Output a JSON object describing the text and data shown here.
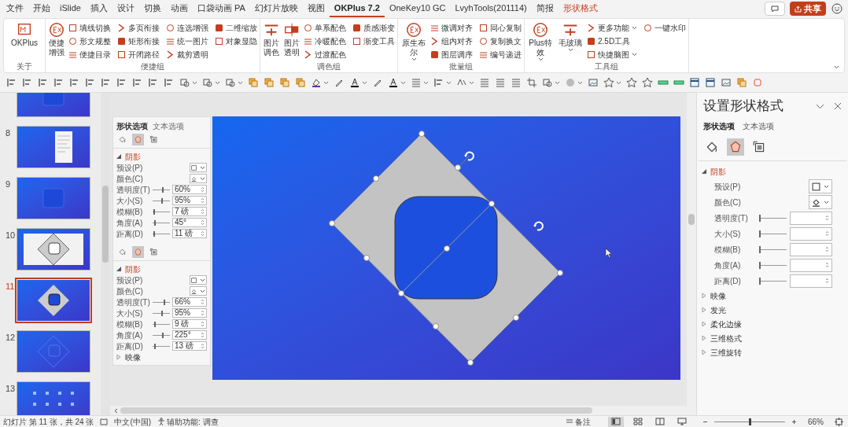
{
  "menu_tabs": [
    {
      "label": "文件",
      "selected": false,
      "kind": "tab"
    },
    {
      "label": "开始",
      "selected": false,
      "kind": "tab"
    },
    {
      "label": "iSlide",
      "selected": false,
      "kind": "tab"
    },
    {
      "label": "插入",
      "selected": false,
      "kind": "tab"
    },
    {
      "label": "设计",
      "selected": false,
      "kind": "tab"
    },
    {
      "label": "切换",
      "selected": false,
      "kind": "tab"
    },
    {
      "label": "动画",
      "selected": false,
      "kind": "tab"
    },
    {
      "label": "口袋动画 PA",
      "selected": false,
      "kind": "tab"
    },
    {
      "label": "幻灯片放映",
      "selected": false,
      "kind": "tab"
    },
    {
      "label": "视图",
      "selected": false,
      "kind": "tab"
    },
    {
      "label": "OKPlus 7.2",
      "selected": true,
      "kind": "tab"
    },
    {
      "label": "OneKey10 GC",
      "selected": false,
      "kind": "tab"
    },
    {
      "label": "LvyhTools(201114)",
      "selected": false,
      "kind": "tab"
    },
    {
      "label": "简报",
      "selected": false,
      "kind": "tab"
    },
    {
      "label": "形状格式",
      "selected": false,
      "kind": "contextual"
    }
  ],
  "share_button": {
    "label": "共享"
  },
  "ribbon": {
    "groups": [
      {
        "label": "关于",
        "large": [
          {
            "label": "OKPlus"
          }
        ]
      },
      {
        "label": "便捷组",
        "large": [
          {
            "label": "便捷增强"
          }
        ],
        "small": [
          {
            "label": "填线切换"
          },
          {
            "label": "形文规整"
          },
          {
            "label": "便捷目录"
          },
          {
            "label": "多页衔接"
          },
          {
            "label": "矩形衔接"
          },
          {
            "label": "开闭路径"
          },
          {
            "label": "连选增强"
          },
          {
            "label": "统一图片"
          },
          {
            "label": "裁剪透明"
          },
          {
            "label": "二维缩放"
          },
          {
            "label": "对象显隐"
          }
        ]
      },
      {
        "label": "调色组",
        "large": [
          {
            "label": "图片调色"
          },
          {
            "label": "图片透明"
          }
        ],
        "small": [
          {
            "label": "单系配色"
          },
          {
            "label": "冷暖配色"
          },
          {
            "label": "过渡配色"
          },
          {
            "label": "质感渐变"
          },
          {
            "label": "渐变工具"
          }
        ]
      },
      {
        "label": "批量组",
        "large": [
          {
            "label": "原生布尔",
            "dropdown": true
          }
        ],
        "small": [
          {
            "label": "微调对齐",
            "dropdown": false
          },
          {
            "label": "组内对齐",
            "dropdown": false
          },
          {
            "label": "图层调序",
            "dropdown": false
          },
          {
            "label": "同心复制",
            "dropdown": false
          },
          {
            "label": "复制换文",
            "dropdown": false
          },
          {
            "label": "编号递进",
            "dropdown": false
          }
        ]
      },
      {
        "label": "工具组",
        "large": [
          {
            "label": "Plus特效",
            "dropdown": true
          },
          {
            "label": "毛玻璃",
            "dropdown": true
          }
        ],
        "small": [
          {
            "label": "更多功能",
            "dropdown": true
          },
          {
            "label": "2.5D工具",
            "dropdown": false
          },
          {
            "label": "快捷脑图",
            "dropdown": true
          },
          {
            "label": "一键水印",
            "dropdown": false
          }
        ]
      }
    ]
  },
  "thumbnails": [
    {
      "kind": "square",
      "selected": false
    },
    {
      "number": "8",
      "kind": "doc",
      "selected": false
    },
    {
      "number": "9",
      "kind": "square",
      "selected": false
    },
    {
      "number": "10",
      "kind": "white-diamond",
      "selected": false
    },
    {
      "number": "11",
      "kind": "diamond",
      "selected": true
    },
    {
      "number": "12",
      "kind": "outline",
      "selected": false
    },
    {
      "number": "13",
      "kind": "grid",
      "selected": false
    }
  ],
  "embedded_panel": {
    "tabs": [
      {
        "label": "形状选项",
        "selected": true
      },
      {
        "label": "文本选项",
        "selected": false
      }
    ],
    "blocks": [
      {
        "categories": [
          {
            "selected": false
          },
          {
            "selected": true
          },
          {
            "selected": false
          }
        ],
        "sections": [
          {
            "label": "阴影",
            "expanded": true,
            "rows": [
              {
                "label": "预设(P)",
                "kind": "preset"
              },
              {
                "label": "颜色(C)",
                "kind": "color"
              },
              {
                "label": "透明度(T)",
                "kind": "slider",
                "level": 0.6,
                "value": "60%"
              },
              {
                "label": "大小(S)",
                "kind": "slider",
                "level": 0.55,
                "value": "95%"
              },
              {
                "label": "模糊(B)",
                "kind": "slider",
                "level": 0.1,
                "value": "7 磅"
              },
              {
                "label": "角度(A)",
                "kind": "slider",
                "level": 0.12,
                "value": "45°"
              },
              {
                "label": "距离(D)",
                "kind": "slider",
                "level": 0.1,
                "value": "11 磅"
              }
            ]
          }
        ]
      },
      {
        "categories": [
          {
            "selected": false
          },
          {
            "selected": true
          },
          {
            "selected": false
          }
        ],
        "sections": [
          {
            "label": "阴影",
            "expanded": true,
            "rows": [
              {
                "label": "预设(P)",
                "kind": "preset"
              },
              {
                "label": "颜色(C)",
                "kind": "color"
              },
              {
                "label": "透明度(T)",
                "kind": "slider",
                "level": 0.66,
                "value": "66%"
              },
              {
                "label": "大小(S)",
                "kind": "slider",
                "level": 0.55,
                "value": "95%"
              },
              {
                "label": "模糊(B)",
                "kind": "slider",
                "level": 0.12,
                "value": "9 磅"
              },
              {
                "label": "角度(A)",
                "kind": "slider",
                "level": 0.6,
                "value": "225°"
              },
              {
                "label": "距离(D)",
                "kind": "slider",
                "level": 0.12,
                "value": "13 磅"
              }
            ]
          },
          {
            "label": "映像",
            "expanded": false
          }
        ]
      }
    ]
  },
  "format_pane": {
    "title": "设置形状格式",
    "tabs": [
      {
        "label": "形状选项",
        "selected": true
      },
      {
        "label": "文本选项",
        "selected": false
      }
    ],
    "categories": [
      {
        "selected": false
      },
      {
        "selected": true
      },
      {
        "selected": false
      }
    ],
    "sections": [
      {
        "label": "阴影",
        "expanded": true,
        "rows": [
          {
            "label": "预设(P)",
            "kind": "preset"
          },
          {
            "label": "颜色(C)",
            "kind": "color"
          },
          {
            "label": "透明度(T)",
            "kind": "slider",
            "level": 0
          },
          {
            "label": "大小(S)",
            "kind": "slider",
            "level": 0
          },
          {
            "label": "模糊(B)",
            "kind": "slider",
            "level": 0
          },
          {
            "label": "角度(A)",
            "kind": "slider",
            "level": 0
          },
          {
            "label": "距离(D)",
            "kind": "slider",
            "level": 0
          }
        ]
      },
      {
        "label": "映像",
        "expanded": false
      },
      {
        "label": "发光",
        "expanded": false
      },
      {
        "label": "柔化边缘",
        "expanded": false
      },
      {
        "label": "三维格式",
        "expanded": false
      },
      {
        "label": "三维旋转",
        "expanded": false
      }
    ]
  },
  "status_bar": {
    "slide_info": "幻灯片 第 11 张，共 24 张",
    "language": "中文(中国)",
    "accessibility": "辅助功能: 调查",
    "notes_button": "备注",
    "view_buttons": [
      {
        "selected": true
      },
      {
        "selected": false
      },
      {
        "selected": false
      },
      {
        "selected": false
      }
    ],
    "zoom": {
      "level": 0.5,
      "reading": "66%"
    }
  }
}
